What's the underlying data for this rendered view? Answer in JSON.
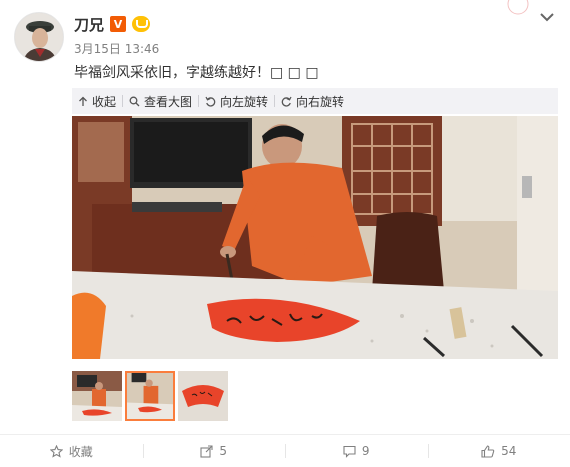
{
  "post": {
    "username": "刀兄",
    "vip_badge": "V",
    "timestamp": "3月15日 13:46",
    "text": "毕福剑风采依旧，字越练越好！□ □ □"
  },
  "media_toolbar": {
    "collapse": "收起",
    "view_large": "查看大图",
    "rotate_left": "向左旋转",
    "rotate_right": "向右旋转"
  },
  "thumbnails": {
    "count": 3,
    "selected_index": 1
  },
  "actions": {
    "favorite": "收藏",
    "share_count": "5",
    "comment_count": "9",
    "like_count": "54"
  },
  "colors": {
    "accent_orange": "#fa7d3c",
    "toolbar_bg": "#f2f2f5",
    "muted_text": "#808080"
  }
}
